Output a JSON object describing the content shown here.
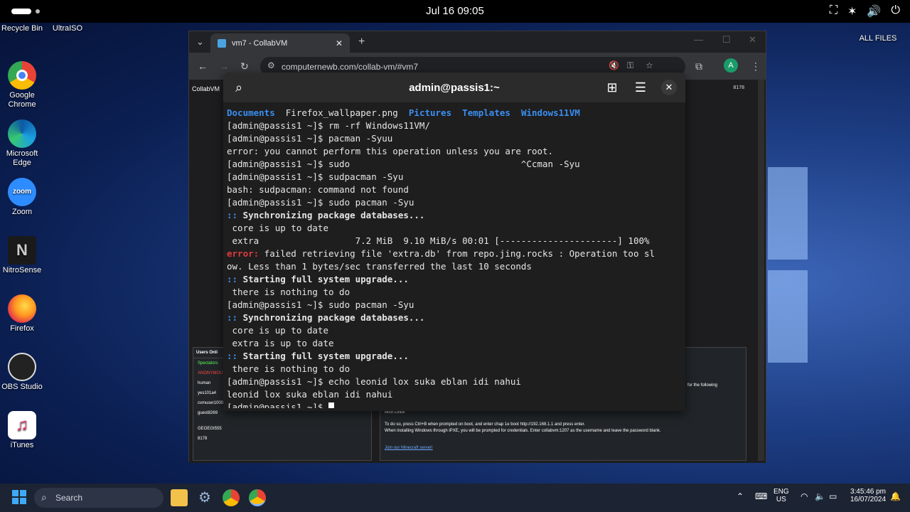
{
  "topbar": {
    "clock": "Jul 16  09:05",
    "tray_icons": [
      "network-icon",
      "accessibility-icon",
      "volume-icon",
      "power-icon"
    ]
  },
  "desktop": {
    "icons": [
      {
        "name": "Recycle Bin"
      },
      {
        "name": "UltraISO"
      },
      {
        "name": "Google Chrome"
      },
      {
        "name": "Microsoft Edge"
      },
      {
        "name": "Zoom"
      },
      {
        "name": "NitroSense"
      },
      {
        "name": "Firefox"
      },
      {
        "name": "OBS Studio"
      },
      {
        "name": "iTunes"
      },
      {
        "name": "ALL FILES"
      }
    ]
  },
  "browser": {
    "tab_title": "vm7 - CollabVM",
    "url": "computernewb.com/collab-vm/#vm7",
    "profile_letter": "A",
    "page": {
      "brand": "CollabVM",
      "users_header": "Users Onli",
      "user_count": "8178",
      "users": [
        "Spectators",
        "ANONYMOU",
        "human",
        "yes101a4",
        "cvmuser1000",
        "guest8269",
        "",
        "GEOEGI555",
        "8178"
      ],
      "info_lines": [
        "Arch Linux",
        "To do so, press Ctrl+B when prompted on boot, and enter chap 1e boot http://192.168.1.1 and press enter.",
        "When installing Windows through iPXE, you will be prompted for credentials. Enter collabvm:1207 as the username and leave the password blank.",
        "Join our Minecraft server!",
        "for the following"
      ]
    }
  },
  "terminal": {
    "title": "admin@passis1:~",
    "lines": [
      [
        {
          "t": "Documents",
          "c": "blue"
        },
        {
          "t": "  Firefox_wallpaper.png  "
        },
        {
          "t": "Pictures",
          "c": "blue"
        },
        {
          "t": "  "
        },
        {
          "t": "Templates",
          "c": "blue"
        },
        {
          "t": "  "
        },
        {
          "t": "Windows11VM",
          "c": "blue"
        }
      ],
      [
        {
          "t": "[admin@passis1 ~]$ rm -rf Windows11VM/"
        }
      ],
      [
        {
          "t": "[admin@passis1 ~]$ pacman -Syuu"
        }
      ],
      [
        {
          "t": "error: you cannot perform this operation unless you are root."
        }
      ],
      [
        {
          "t": "[admin@passis1 ~]$ sudo                                ^Ccman -Syu"
        }
      ],
      [
        {
          "t": "[admin@passis1 ~]$ sudpacman -Syu"
        }
      ],
      [
        {
          "t": "bash: sudpacman: command not found"
        }
      ],
      [
        {
          "t": "[admin@passis1 ~]$ sudo pacman -Syu"
        }
      ],
      [
        {
          "t": ":: ",
          "c": "blue"
        },
        {
          "t": "Synchronizing package databases...",
          "c": "bold"
        }
      ],
      [
        {
          "t": " core is up to date"
        }
      ],
      [
        {
          "t": " extra                  7.2 MiB  9.10 MiB/s 00:01 [----------------------] 100%"
        }
      ],
      [
        {
          "t": "error:",
          "c": "red"
        },
        {
          "t": " failed retrieving file 'extra.db' from repo.jing.rocks : Operation too sl"
        }
      ],
      [
        {
          "t": "ow. Less than 1 bytes/sec transferred the last 10 seconds"
        }
      ],
      [
        {
          "t": ":: ",
          "c": "blue"
        },
        {
          "t": "Starting full system upgrade...",
          "c": "bold"
        }
      ],
      [
        {
          "t": " there is nothing to do"
        }
      ],
      [
        {
          "t": "[admin@passis1 ~]$ sudo pacman -Syu"
        }
      ],
      [
        {
          "t": ":: ",
          "c": "blue"
        },
        {
          "t": "Synchronizing package databases...",
          "c": "bold"
        }
      ],
      [
        {
          "t": " core is up to date"
        }
      ],
      [
        {
          "t": " extra is up to date"
        }
      ],
      [
        {
          "t": ":: ",
          "c": "blue"
        },
        {
          "t": "Starting full system upgrade...",
          "c": "bold"
        }
      ],
      [
        {
          "t": " there is nothing to do"
        }
      ],
      [
        {
          "t": "[admin@passis1 ~]$ echo leonid lox suka eblan idi nahui"
        }
      ],
      [
        {
          "t": "leonid lox suka eblan idi nahui"
        }
      ],
      [
        {
          "t": "[admin@passis1 ~]$ "
        }
      ]
    ]
  },
  "taskbar": {
    "search_placeholder": "Search",
    "lang_top": "ENG",
    "lang_bottom": "US",
    "time": "3:45:46 pm",
    "date": "16/07/2024"
  }
}
